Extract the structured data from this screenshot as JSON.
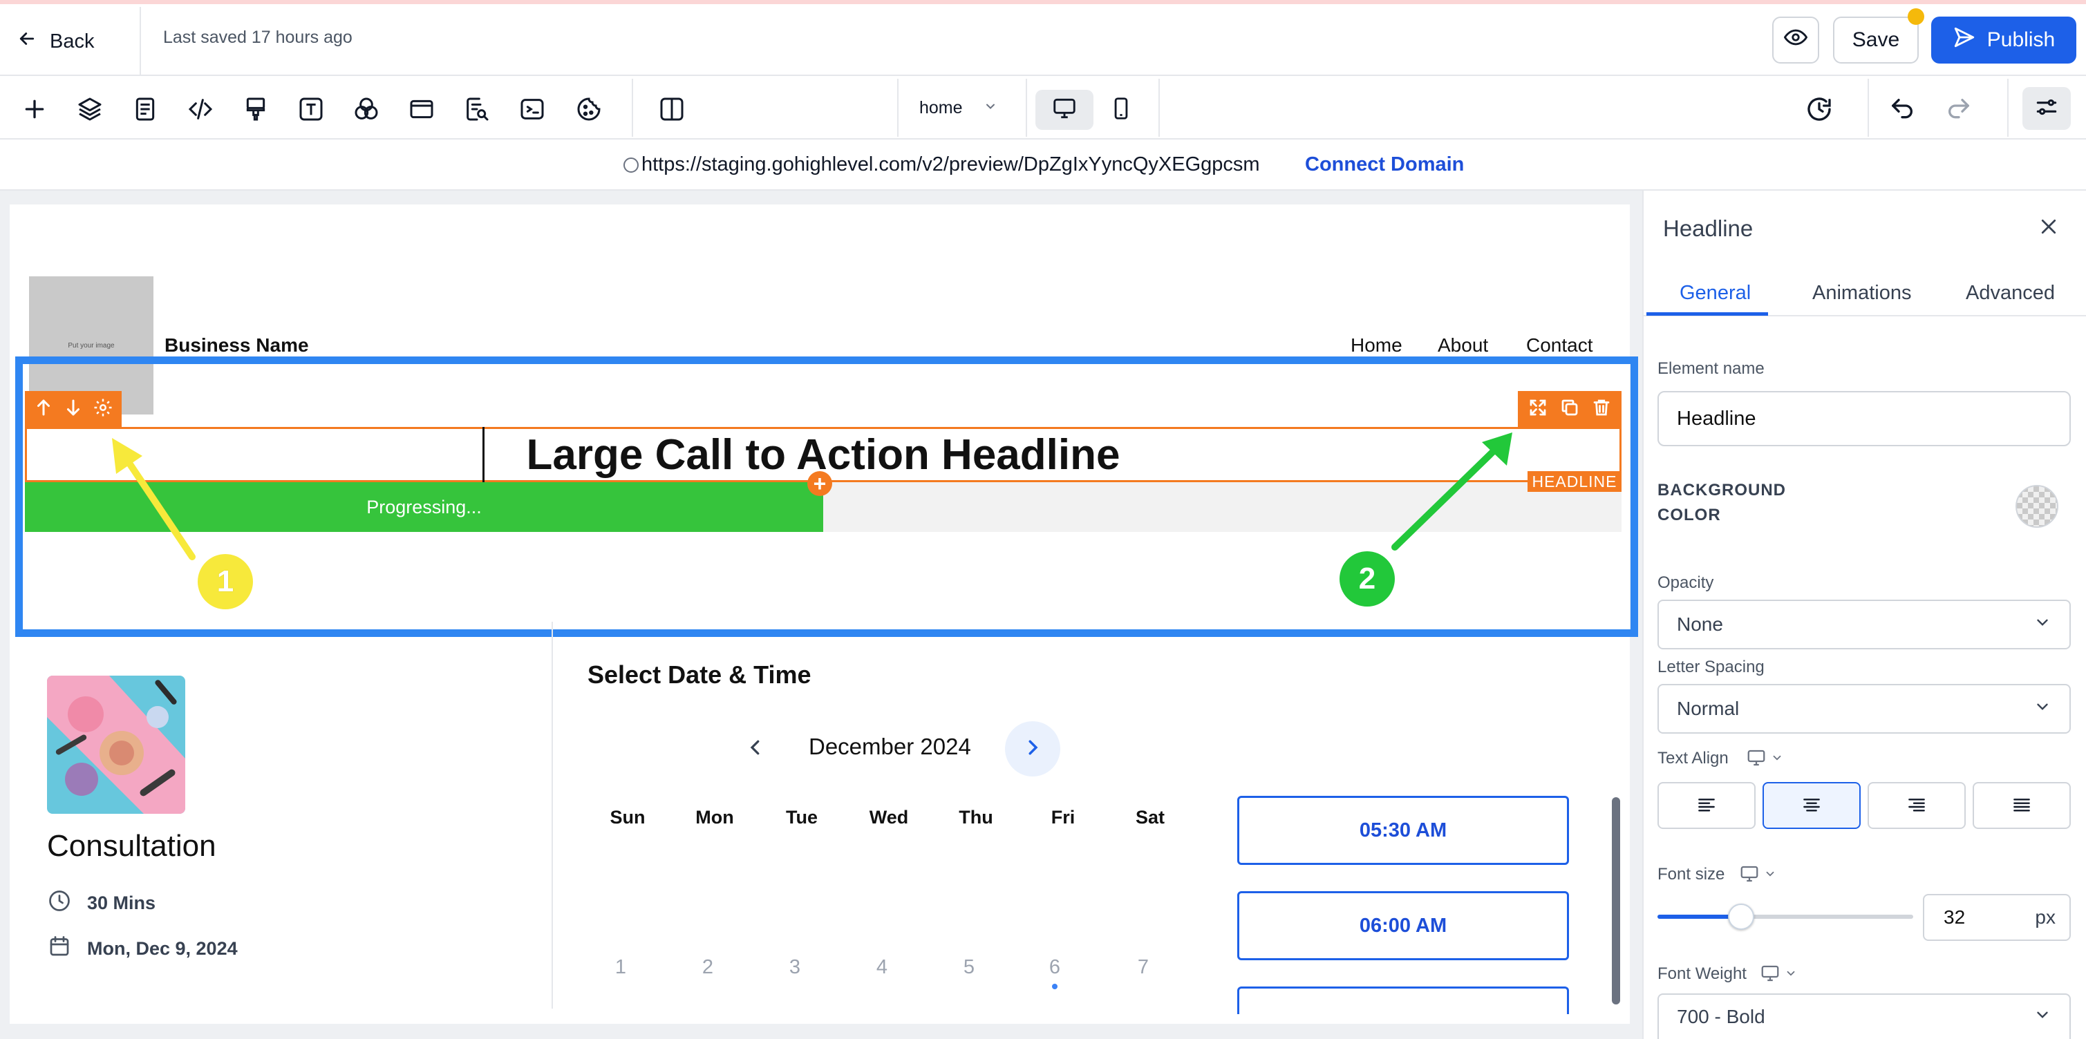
{
  "header": {
    "back_label": "Back",
    "last_saved": "Last saved 17 hours ago",
    "save_label": "Save",
    "publish_label": "Publish"
  },
  "toolbar": {
    "page_select": "home",
    "icons": [
      "add-icon",
      "layers-icon",
      "pages-icon",
      "code-icon",
      "paint-brush-icon",
      "text-icon",
      "color-palette-icon",
      "section-icon",
      "seo-icon",
      "terminal-icon",
      "cookie-icon",
      "split-view-icon"
    ],
    "right_icons": [
      "history-icon",
      "undo-icon",
      "redo-icon",
      "settings-sliders-icon"
    ]
  },
  "url_bar": {
    "url": "https://staging.gohighlevel.com/v2/preview/DpZgIxYyncQyXEGgpcsm",
    "connect_label": "Connect Domain"
  },
  "canvas": {
    "logo_placeholder": "Put your image",
    "business_name": "Business Name",
    "nav": [
      "Home",
      "About",
      "Contact"
    ],
    "headline": "Large Call to Action Headline",
    "headline_tag": "HEADLINE",
    "progress_label": "Progressing...",
    "progress_fraction": 0.5,
    "annotations": [
      "1",
      "2"
    ],
    "annotation_colors": {
      "one": "#f7e93b",
      "two": "#22c83a",
      "frame": "#2f86f2"
    },
    "booking": {
      "service_title": "Consultation",
      "duration": "30 Mins",
      "date": "Mon, Dec 9, 2024",
      "select_title": "Select Date & Time",
      "month": "December 2024",
      "weekdays": [
        "Sun",
        "Mon",
        "Tue",
        "Wed",
        "Thu",
        "Fri",
        "Sat"
      ],
      "days": [
        "1",
        "2",
        "3",
        "4",
        "5",
        "6",
        "7"
      ],
      "time_slots": [
        "05:30 AM",
        "06:00 AM"
      ]
    }
  },
  "panel": {
    "title": "Headline",
    "tabs": [
      "General",
      "Animations",
      "Advanced"
    ],
    "element_name_label": "Element name",
    "element_name_value": "Headline",
    "bg_color_label_1": "BACKGROUND",
    "bg_color_label_2": "COLOR",
    "opacity_label": "Opacity",
    "opacity_value": "None",
    "letter_spacing_label": "Letter Spacing",
    "letter_spacing_value": "Normal",
    "text_align_label": "Text Align",
    "font_size_label": "Font size",
    "font_size_value": "32",
    "font_size_unit": "px",
    "font_weight_label": "Font Weight",
    "font_weight_value": "700 - Bold"
  },
  "colors": {
    "accent": "#1d60e8",
    "orange": "#f47a20",
    "progress_green": "#36c43c"
  }
}
